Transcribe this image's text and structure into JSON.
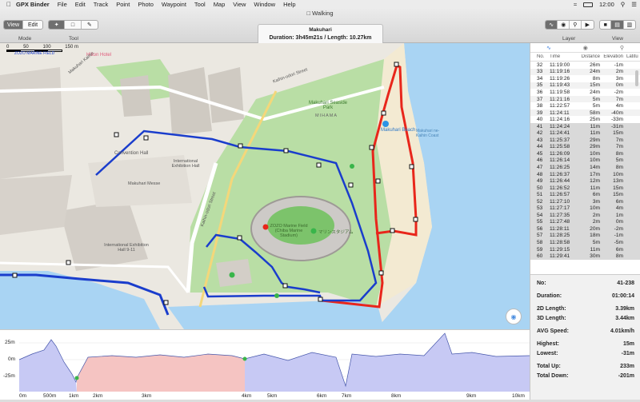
{
  "menubar": {
    "apple_icon": "apple-icon",
    "app": "GPX Binder",
    "items": [
      "File",
      "Edit",
      "Track",
      "Point",
      "Photo",
      "Waypoint",
      "Tool",
      "Map",
      "View",
      "Window",
      "Help"
    ],
    "clock": "12:00"
  },
  "window": {
    "title": "Walking"
  },
  "toolbar": {
    "mode_view": "View",
    "mode_edit": "Edit",
    "mode_label": "Mode",
    "tool_label": "Tool",
    "layer_label": "Layer",
    "view_label": "View"
  },
  "info": {
    "name": "Makuhari",
    "summary": "Duration: 3h45m21s  /  Length: 10.27km"
  },
  "map": {
    "scale": {
      "t0": "0",
      "t1": "50",
      "t2": "100",
      "t3": "150 m"
    },
    "labels": {
      "zozo": "ZOZO MARINE FIELD",
      "hotel": "Hilton Hotel",
      "makuhari_kaihin": "Makuhari Kaihin",
      "street_top": "Kaihin-odori Street",
      "seaside": "Makuhari Seaside Park",
      "mihama": "MIHAMA",
      "beach": "Makuhari Beach",
      "beach_coast": "Makuhari ne-Kaihin Coast",
      "convention": "Convention Hall",
      "exhibition": "International Exhibition Hall",
      "messe": "Makuhari Messe",
      "stadium": "ZOZO Marine Field (Chiba Marine Stadium)",
      "stadium_jp": "マリンスタジアム",
      "street_mid": "Kaihin-odori Street",
      "exhibit2": "International Exhibition Hall 9-11"
    }
  },
  "profile": {
    "y_ticks": [
      "25m",
      "0m",
      "-25m"
    ],
    "x_ticks": [
      "0m",
      "500m",
      "1km",
      "2km",
      "3km",
      "4km",
      "5km",
      "6km",
      "7km",
      "8km",
      "9km",
      "10km"
    ]
  },
  "table": {
    "tabs": [
      "track-icon",
      "photo-icon",
      "waypoint-icon"
    ],
    "headers": [
      "No.",
      "Time",
      "Distance",
      "Elevation",
      "Latitu"
    ],
    "rows": [
      [
        "32",
        "11:19:00",
        "26m",
        "-1m"
      ],
      [
        "33",
        "11:19:16",
        "24m",
        "2m"
      ],
      [
        "34",
        "11:19:26",
        "8m",
        "3m"
      ],
      [
        "35",
        "11:19:43",
        "15m",
        "0m"
      ],
      [
        "36",
        "11:19:58",
        "24m",
        "-2m"
      ],
      [
        "37",
        "11:21:16",
        "5m",
        "7m"
      ],
      [
        "38",
        "11:22:57",
        "5m",
        "4m"
      ],
      [
        "39",
        "11:24:11",
        "58m",
        "-40m"
      ],
      [
        "40",
        "11:24:16",
        "25m",
        "-33m"
      ],
      [
        "41",
        "11:24:24",
        "11m",
        "-31m"
      ],
      [
        "42",
        "11:24:41",
        "11m",
        "15m"
      ],
      [
        "43",
        "11:25:37",
        "29m",
        "7m"
      ],
      [
        "44",
        "11:25:58",
        "29m",
        "7m"
      ],
      [
        "45",
        "11:26:09",
        "10m",
        "8m"
      ],
      [
        "46",
        "11:26:14",
        "10m",
        "5m"
      ],
      [
        "47",
        "11:26:25",
        "14m",
        "8m"
      ],
      [
        "48",
        "11:26:37",
        "17m",
        "10m"
      ],
      [
        "49",
        "11:26:44",
        "12m",
        "13m"
      ],
      [
        "50",
        "11:26:52",
        "11m",
        "15m"
      ],
      [
        "51",
        "11:26:57",
        "6m",
        "15m"
      ],
      [
        "52",
        "11:27:10",
        "3m",
        "6m"
      ],
      [
        "53",
        "11:27:17",
        "10m",
        "4m"
      ],
      [
        "54",
        "11:27:35",
        "2m",
        "1m"
      ],
      [
        "55",
        "11:27:48",
        "2m",
        "0m"
      ],
      [
        "56",
        "11:28:11",
        "20m",
        "-2m"
      ],
      [
        "57",
        "11:28:25",
        "18m",
        "-1m"
      ],
      [
        "58",
        "11:28:58",
        "5m",
        "-5m"
      ],
      [
        "59",
        "11:29:15",
        "11m",
        "6m"
      ],
      [
        "60",
        "11:29:41",
        "30m",
        "8m"
      ]
    ]
  },
  "stats": {
    "no_label": "No:",
    "no_value": "41-238",
    "dur_label": "Duration:",
    "dur_value": "01:00:14",
    "l2_label": "2D Length:",
    "l2_value": "3.39km",
    "l3_label": "3D Length:",
    "l3_value": "3.44km",
    "spd_label": "AVG Speed:",
    "spd_value": "4.01km/h",
    "hi_label": "Highest:",
    "hi_value": "15m",
    "lo_label": "Lowest:",
    "lo_value": "-31m",
    "up_label": "Total Up:",
    "up_value": "233m",
    "down_label": "Total Down:",
    "down_value": "-201m"
  }
}
